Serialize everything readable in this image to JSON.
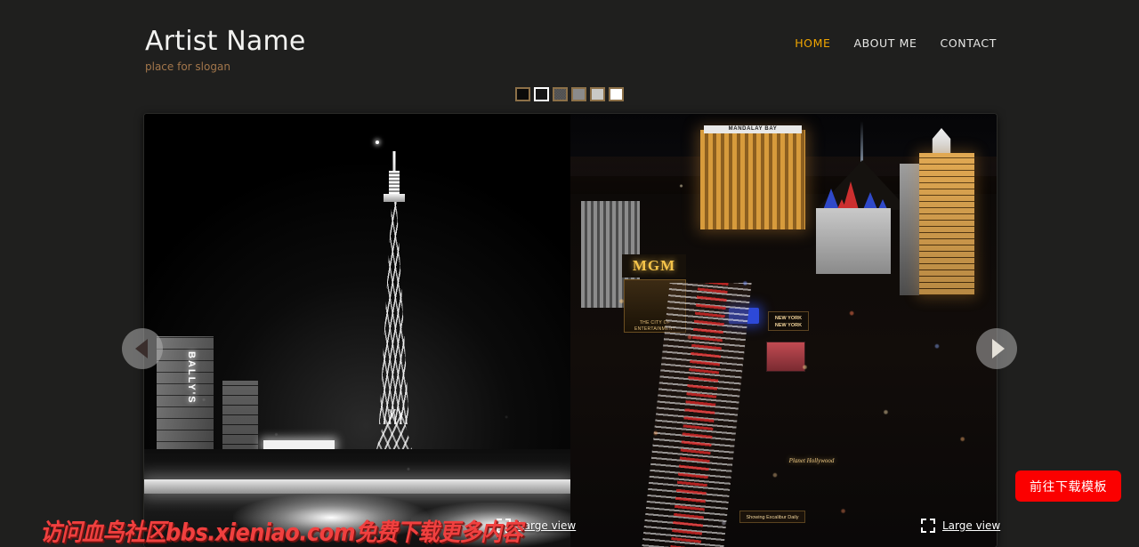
{
  "site": {
    "title": "Artist Name",
    "slogan": "place for slogan"
  },
  "nav": {
    "items": [
      {
        "label": "HOME",
        "active": true
      },
      {
        "label": "ABOUT ME",
        "active": false
      },
      {
        "label": "CONTACT",
        "active": false
      }
    ]
  },
  "pager": {
    "count": 6,
    "active_index": 1,
    "border_color": "#8c7048",
    "active_border_color": "#ffffff",
    "swatch_fills": [
      "#0a0a0a",
      "#161616",
      "#4d4d4d",
      "#8b8b8b",
      "#c9c9c6",
      "#ffffff"
    ]
  },
  "gallery": {
    "prev_label": "◀",
    "next_label": "▶",
    "large_view_label": "Large view",
    "slides": [
      {
        "name": "las-vegas-strip-black-and-white",
        "sign_text": "BALLY'S"
      },
      {
        "name": "las-vegas-strip-aerial-night-color",
        "signs": {
          "mandalay": "MANDALAY BAY",
          "mgm": "MGM",
          "mgm_board": "THE CITY OF ENTERTAINMENT",
          "nyny": "NEW YORK NEW YORK",
          "planet": "Planet Hollywood",
          "bottom": "Showing Excalibur Daily"
        }
      }
    ]
  },
  "watermark": {
    "text": "访问血鸟社区bbs.xieniao.com免费下载更多内容",
    "color": "#f0403f"
  },
  "cta": {
    "label": "前往下载模板",
    "color": "#fb0000"
  },
  "theme": {
    "background": "#1f1f1e",
    "accent": "#f0a500",
    "slogan_color": "#a2764b"
  }
}
